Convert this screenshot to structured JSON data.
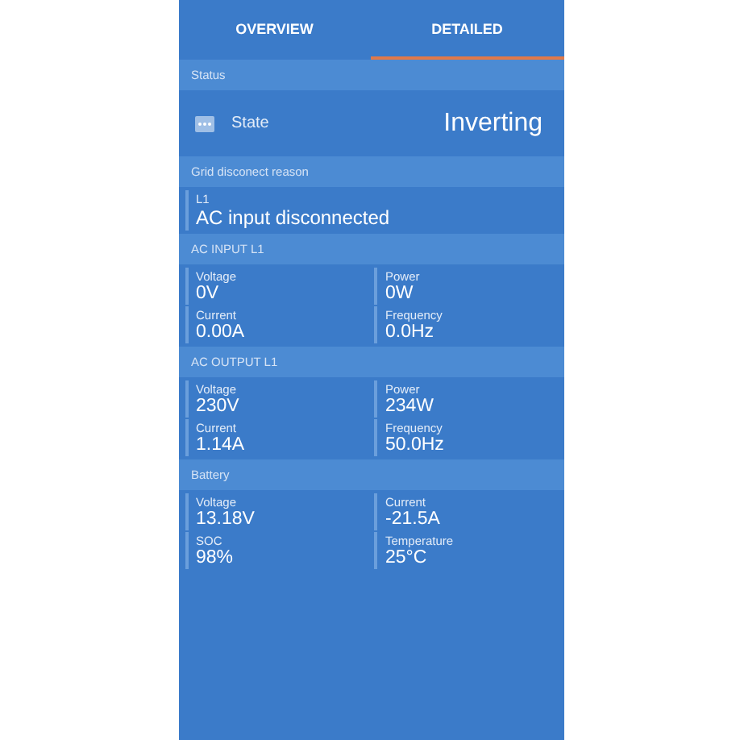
{
  "tabs": [
    {
      "label": "OVERVIEW",
      "selected": false
    },
    {
      "label": "DETAILED",
      "selected": true
    }
  ],
  "sections": [
    {
      "kind": "state",
      "title": "Status",
      "label": "State",
      "value": "Inverting"
    },
    {
      "kind": "single",
      "title": "Grid disconect reason",
      "items": [
        {
          "label": "L1",
          "value": "AC input disconnected"
        }
      ]
    },
    {
      "kind": "grid",
      "title": "AC INPUT L1",
      "items": [
        {
          "label": "Voltage",
          "value": "0V"
        },
        {
          "label": "Power",
          "value": "0W"
        },
        {
          "label": "Current",
          "value": "0.00A"
        },
        {
          "label": "Frequency",
          "value": "0.0Hz"
        }
      ]
    },
    {
      "kind": "grid",
      "title": "AC OUTPUT L1",
      "items": [
        {
          "label": "Voltage",
          "value": "230V"
        },
        {
          "label": "Power",
          "value": "234W"
        },
        {
          "label": "Current",
          "value": "1.14A"
        },
        {
          "label": "Frequency",
          "value": "50.0Hz"
        }
      ]
    },
    {
      "kind": "grid",
      "title": "Battery",
      "items": [
        {
          "label": "Voltage",
          "value": "13.18V"
        },
        {
          "label": "Current",
          "value": "-21.5A"
        },
        {
          "label": "SOC",
          "value": "98%"
        },
        {
          "label": "Temperature",
          "value": "25°C"
        }
      ]
    }
  ]
}
